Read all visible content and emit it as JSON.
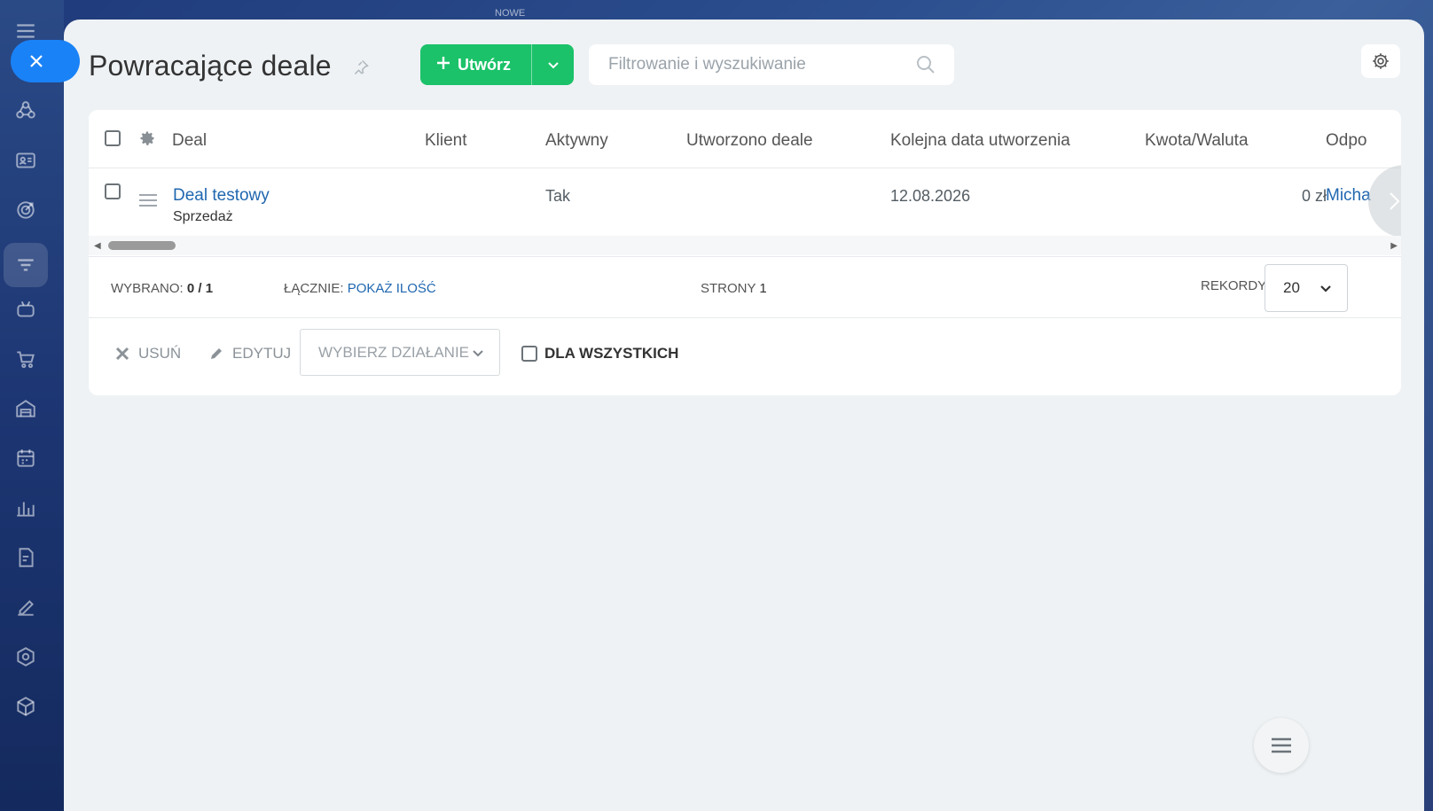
{
  "top_hint": "NOWE",
  "sidebar": {
    "icons": [
      "menu-icon",
      "crm-icon",
      "contacts-icon",
      "target-icon",
      "filter-icon",
      "robot-icon",
      "cart-icon",
      "warehouse-icon",
      "calendar-icon",
      "chart-icon",
      "document-icon",
      "sign-icon",
      "hexagon-icon",
      "cube-icon"
    ]
  },
  "header": {
    "title": "Powracające deale",
    "create_label": "Utwórz",
    "search_placeholder": "Filtrowanie i wyszukiwanie"
  },
  "grid": {
    "columns": [
      "Deal",
      "Klient",
      "Aktywny",
      "Utworzono deale",
      "Kolejna data utworzenia",
      "Kwota/Waluta",
      "Odpo"
    ],
    "rows": [
      {
        "deal": "Deal testowy",
        "deal_sub": "Sprzedaż",
        "client": "",
        "active": "Tak",
        "created_deals": "",
        "next_date": "12.08.2026",
        "amount": "0 zł",
        "responsible": "Micha"
      }
    ]
  },
  "footer": {
    "selected_label": "WYBRANO:",
    "selected_value": "0 / 1",
    "total_label": "ŁĄCZNIE:",
    "total_link": "POKAŻ ILOŚĆ",
    "pages_label": "STRONY",
    "pages_value": "1",
    "records_label": "REKORDY:",
    "records_value": "20"
  },
  "actions": {
    "delete_label": "USUŃ",
    "edit_label": "EDYTUJ",
    "select_action_label": "WYBIERZ DZIAŁANIE",
    "for_all_label": "DLA WSZYSTKICH"
  },
  "colors": {
    "accent_green": "#1bc269",
    "link_blue": "#2067b0",
    "close_blue": "#1a82f7"
  }
}
